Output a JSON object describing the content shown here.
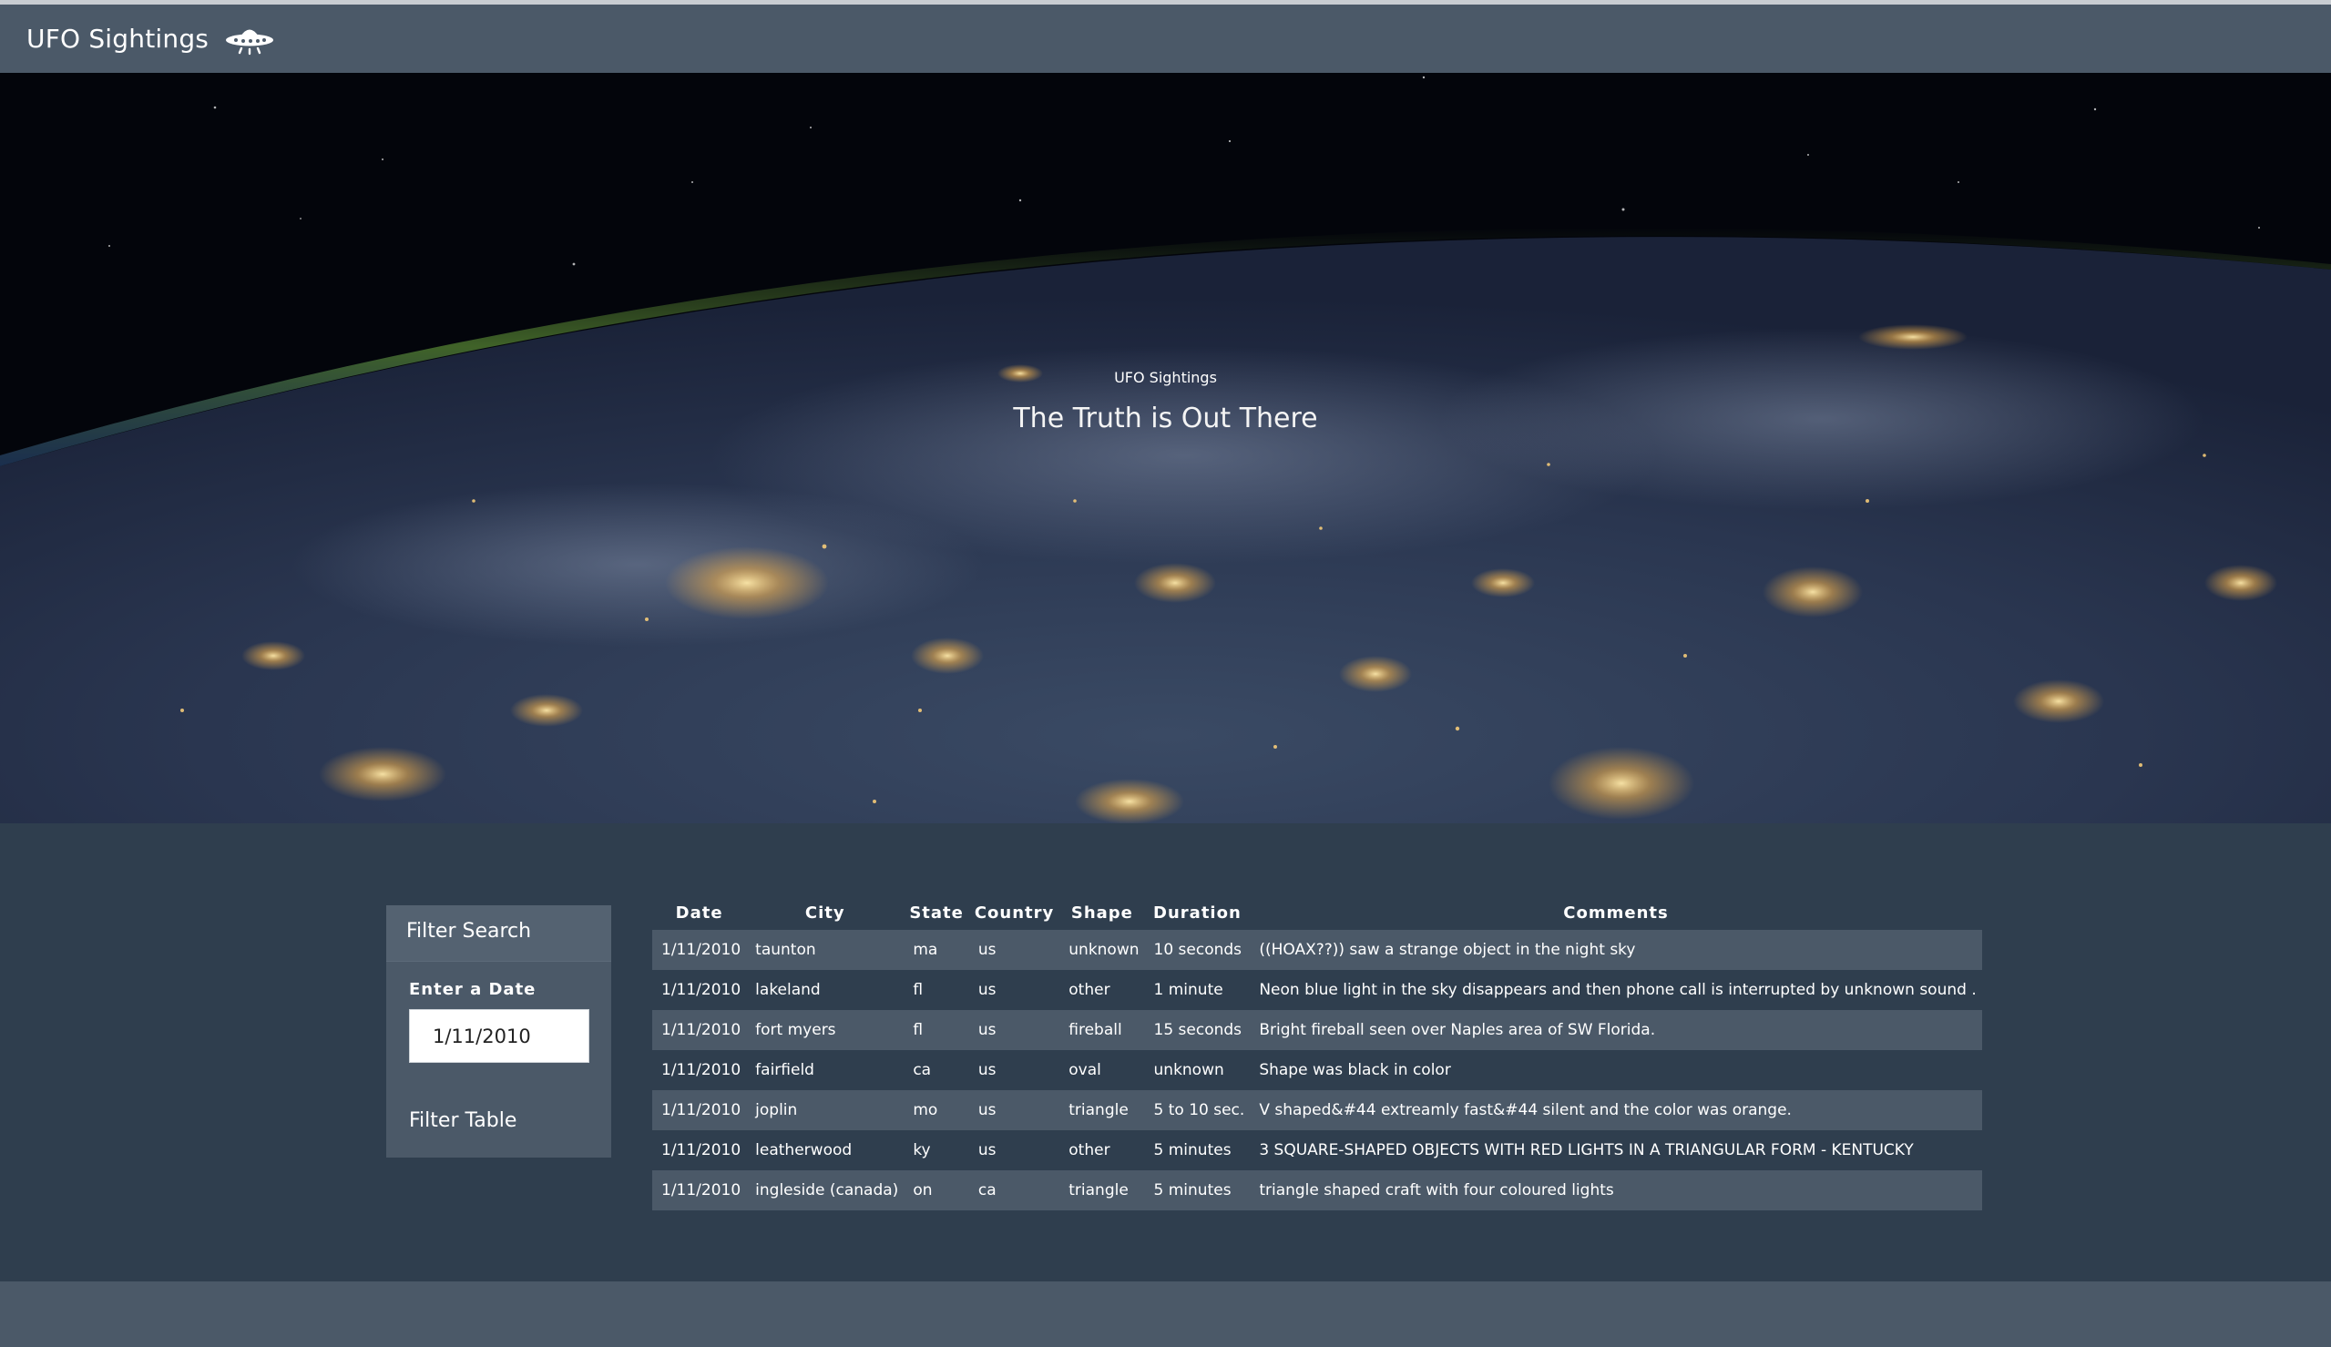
{
  "navbar": {
    "brand": "UFO Sightings",
    "brand_icon": "ufo-icon"
  },
  "hero": {
    "subtitle": "UFO Sightings",
    "title": "The Truth is Out There"
  },
  "filter": {
    "heading": "Filter Search",
    "date_label": "Enter a Date",
    "date_value": "1/11/2010",
    "button_label": "Filter Table"
  },
  "table": {
    "headers": [
      "Date",
      "City",
      "State",
      "Country",
      "Shape",
      "Duration",
      "Comments"
    ],
    "rows": [
      [
        "1/11/2010",
        "taunton",
        "ma",
        "us",
        "unknown",
        "10 seconds",
        "((HOAX??)) saw a strange object in the night sky"
      ],
      [
        "1/11/2010",
        "lakeland",
        "fl",
        "us",
        "other",
        "1 minute",
        "Neon blue light in the sky disappears and then phone call is interrupted by unknown sound ."
      ],
      [
        "1/11/2010",
        "fort myers",
        "fl",
        "us",
        "fireball",
        "15 seconds",
        "Bright fireball seen over Naples area of SW Florida."
      ],
      [
        "1/11/2010",
        "fairfield",
        "ca",
        "us",
        "oval",
        "unknown",
        "Shape was black in color"
      ],
      [
        "1/11/2010",
        "joplin",
        "mo",
        "us",
        "triangle",
        "5 to 10 sec.",
        "V shaped&#44 extreamly fast&#44 silent and the color was orange."
      ],
      [
        "1/11/2010",
        "leatherwood",
        "ky",
        "us",
        "other",
        "5 minutes",
        "3 SQUARE-SHAPED OBJECTS WITH RED LIGHTS IN A TRIANGULAR FORM - KENTUCKY"
      ],
      [
        "1/11/2010",
        "ingleside (canada)",
        "on",
        "ca",
        "triangle",
        "5 minutes",
        "triangle shaped craft with four coloured lights"
      ]
    ]
  },
  "colors": {
    "navbar": "#4b5968",
    "body": "#2f3e4e",
    "stripe": "#4b5968"
  }
}
